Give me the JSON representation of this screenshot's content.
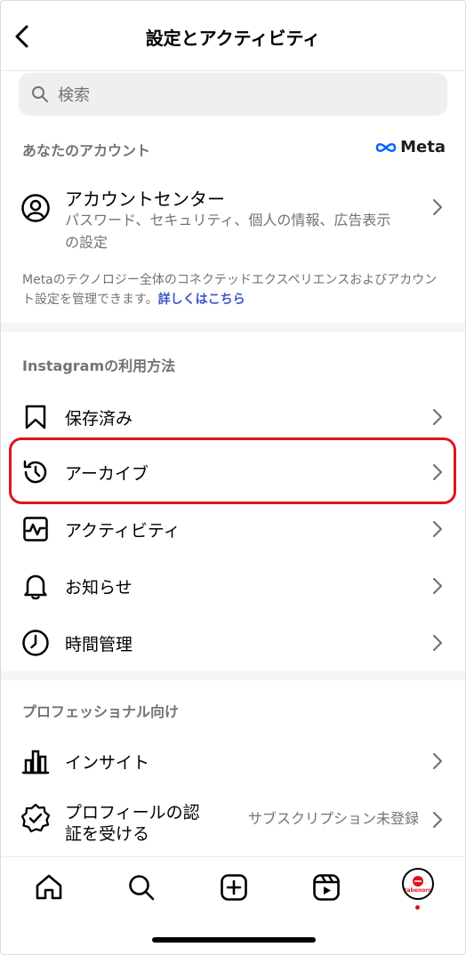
{
  "header": {
    "title": "設定とアクティビティ"
  },
  "search": {
    "placeholder": "検索"
  },
  "account_section": {
    "label": "あなたのアカウント",
    "brand": "Meta",
    "center": {
      "title": "アカウントセンター",
      "subtitle": "パスワード、セキュリティ、個人の情報、広告表示の設定"
    },
    "info_text": "Metaのテクノロジー全体のコネクテッドエクスペリエンスおよびアカウント設定を管理できます。",
    "info_link": "詳しくはこちら"
  },
  "usage_section": {
    "label": "Instagramの利用方法",
    "items": [
      {
        "label": "保存済み",
        "icon": "bookmark-icon"
      },
      {
        "label": "アーカイブ",
        "icon": "archive-history-icon"
      },
      {
        "label": "アクティビティ",
        "icon": "activity-icon"
      },
      {
        "label": "お知らせ",
        "icon": "bell-icon"
      },
      {
        "label": "時間管理",
        "icon": "clock-icon"
      }
    ]
  },
  "pro_section": {
    "label": "プロフェッショナル向け",
    "items": [
      {
        "label": "インサイト",
        "icon": "bar-chart-icon"
      },
      {
        "label": "プロフィールの認証を受ける",
        "status": "サブスクリプション未登録",
        "icon": "verified-badge-icon"
      }
    ]
  },
  "tabbar": {
    "items": [
      "home-icon",
      "search-icon",
      "create-icon",
      "reels-icon",
      "profile-avatar"
    ],
    "avatar_text": "tabenoro"
  },
  "colors": {
    "highlight": "#e0131f",
    "link": "#3d55c9",
    "secondary_text": "#737373"
  }
}
